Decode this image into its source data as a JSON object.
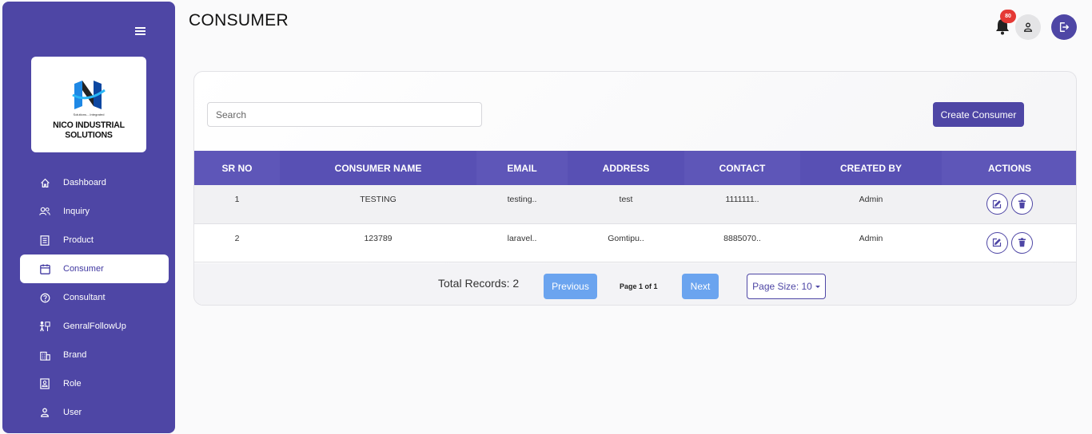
{
  "sidebar": {
    "logo": {
      "tagline": "Solutions....Integrated",
      "company": "NICO INDUSTRIAL SOLUTIONS"
    },
    "items": [
      {
        "label": "Dashboard",
        "icon": "home-icon"
      },
      {
        "label": "Inquiry",
        "icon": "users-icon"
      },
      {
        "label": "Product",
        "icon": "list-icon"
      },
      {
        "label": "Consumer",
        "icon": "calendar-icon",
        "active": true
      },
      {
        "label": "Consultant",
        "icon": "question-circle-icon"
      },
      {
        "label": "GenralFollowUp",
        "icon": "followup-icon"
      },
      {
        "label": "Brand",
        "icon": "building-icon"
      },
      {
        "label": "Role",
        "icon": "id-card-icon"
      },
      {
        "label": "User",
        "icon": "user-icon"
      }
    ]
  },
  "header": {
    "title": "CONSUMER",
    "notification_count": "80"
  },
  "toolbar": {
    "search_placeholder": "Search",
    "create_label": "Create Consumer"
  },
  "table": {
    "columns": [
      "SR NO",
      "CONSUMER NAME",
      "EMAIL",
      "ADDRESS",
      "CONTACT",
      "CREATED BY",
      "ACTIONS"
    ],
    "rows": [
      {
        "sr": "1",
        "name": "TESTING",
        "email": "testing..",
        "address": "test",
        "contact": "1111111..",
        "created_by": "Admin"
      },
      {
        "sr": "2",
        "name": "123789",
        "email": "laravel..",
        "address": "Gomtipu..",
        "contact": "8885070..",
        "created_by": "Admin"
      }
    ]
  },
  "pagination": {
    "total": "Total Records: 2",
    "previous_label": "Previous",
    "page_info": "Page 1 of 1",
    "next_label": "Next",
    "page_size": "Page Size: 10"
  },
  "colors": {
    "brand": "#4e46a5",
    "pager_button": "#6ba4ef",
    "badge": "#e53935"
  }
}
